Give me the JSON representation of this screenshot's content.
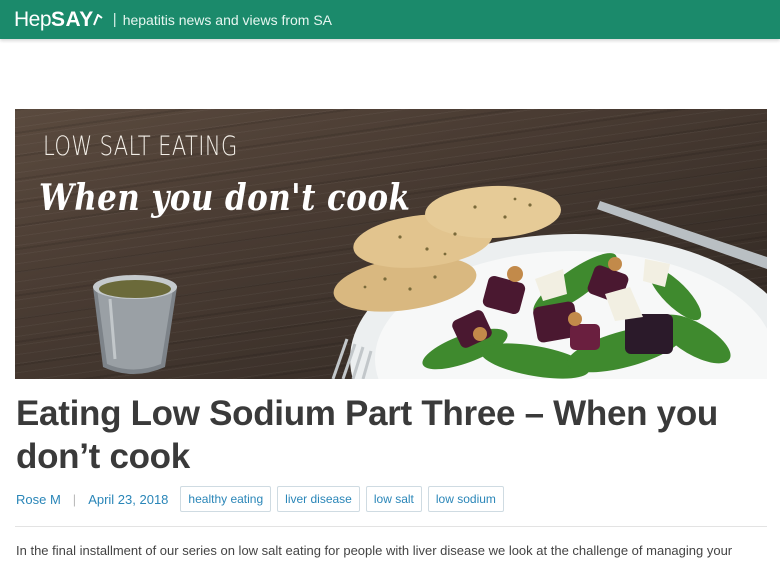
{
  "header": {
    "logo_part1": "Hep",
    "logo_part2": "SAY",
    "divider": "|",
    "tagline": "hepatitis news and views from SA",
    "bg_color": "#1b8a6b"
  },
  "hero": {
    "kicker": "LOW SALT EATING",
    "script_title": "When you don't cook"
  },
  "post": {
    "title": "Eating Low Sodium Part Three – When you don’t cook",
    "author": "Rose M",
    "separator": "|",
    "date": "April 23, 2018",
    "tags": [
      "healthy eating",
      "liver disease",
      "low salt",
      "low sodium"
    ],
    "excerpt": "In the final installment of our series on low salt eating for people with liver disease we look at the challenge of managing your"
  },
  "colors": {
    "accent_link": "#2a86b8",
    "title_text": "#3a3a3a"
  }
}
